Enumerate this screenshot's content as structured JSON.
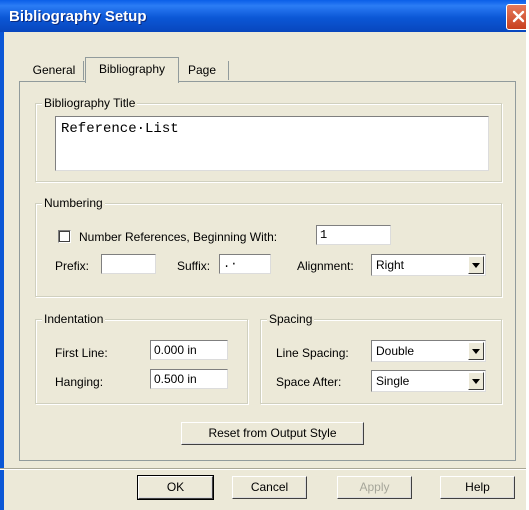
{
  "window": {
    "title": "Bibliography Setup"
  },
  "tabs": [
    {
      "label": "General",
      "active": false
    },
    {
      "label": "Bibliography",
      "active": true
    },
    {
      "label": "Page",
      "active": false
    }
  ],
  "bibliography_title": {
    "label": "Bibliography Title",
    "value": "Reference·List"
  },
  "numbering": {
    "label": "Numbering",
    "number_references_label": "Number References, Beginning With:",
    "number_references_checked": false,
    "start_value": "1",
    "prefix_label": "Prefix:",
    "prefix_value": "",
    "suffix_label": "Suffix:",
    "suffix_value": ".·",
    "alignment_label": "Alignment:",
    "alignment_value": "Right"
  },
  "indentation": {
    "label": "Indentation",
    "first_line_label": "First Line:",
    "first_line_value": "0.000 in",
    "hanging_label": "Hanging:",
    "hanging_value": "0.500 in"
  },
  "spacing": {
    "label": "Spacing",
    "line_spacing_label": "Line Spacing:",
    "line_spacing_value": "Double",
    "space_after_label": "Space After:",
    "space_after_value": "Single"
  },
  "reset_button": "Reset from Output Style",
  "footer": {
    "ok": "OK",
    "cancel": "Cancel",
    "apply": "Apply",
    "help": "Help"
  },
  "colors": {
    "title_bar": "#0b57d6",
    "dialog_bg": "#ece9d8",
    "close_button": "#c8401f"
  },
  "icons": {
    "close": "close-icon",
    "dropdown": "chevron-down-icon"
  }
}
